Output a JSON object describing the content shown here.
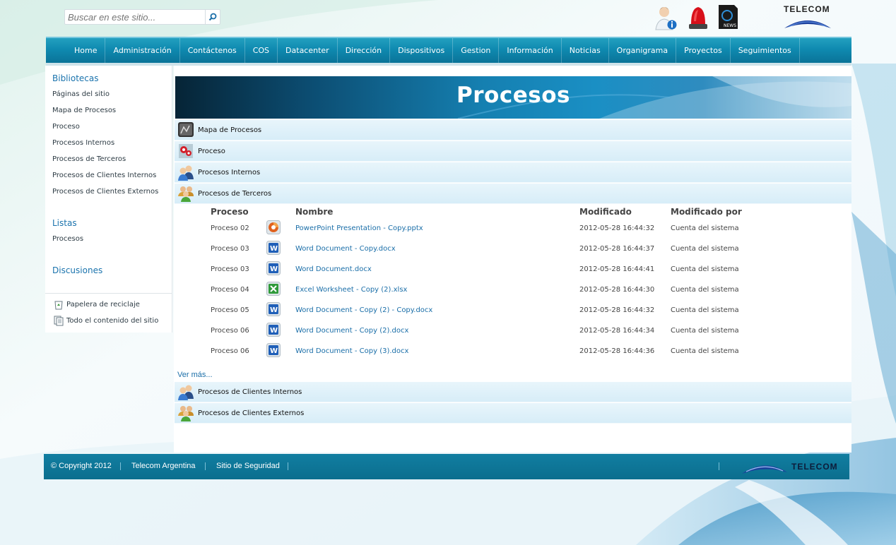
{
  "search": {
    "placeholder": "Buscar en este sitio..."
  },
  "header": {
    "brand": "TELECOM",
    "icons": [
      "user-info-icon",
      "alarm-light-icon",
      "news-icon"
    ]
  },
  "nav": {
    "items": [
      "Home",
      "Administración",
      "Contáctenos",
      "COS",
      "Datacenter",
      "Dirección",
      "Dispositivos",
      "Gestion",
      "Información",
      "Noticias",
      "Organigrama",
      "Proyectos",
      "Seguimientos"
    ]
  },
  "sidebar": {
    "bibliotecas": {
      "heading": "Bibliotecas",
      "items": [
        "Páginas del sitio",
        "Mapa de Procesos",
        "Proceso",
        "Procesos Internos",
        "Procesos de Terceros",
        "Procesos de Clientes Internos",
        "Procesos de Clientes Externos"
      ]
    },
    "listas": {
      "heading": "Listas",
      "items": [
        "Procesos"
      ]
    },
    "discusiones": {
      "heading": "Discusiones"
    },
    "utilities": [
      "Papelera de reciclaje",
      "Todo el contenido del sitio"
    ]
  },
  "main": {
    "title": "Procesos",
    "sections_top": [
      "Mapa de Procesos",
      "Proceso",
      "Procesos Internos",
      "Procesos de Terceros"
    ],
    "table": {
      "headers": {
        "proceso": "Proceso",
        "nombre": "Nombre",
        "modificado": "Modificado",
        "modificado_por": "Modificado por"
      },
      "rows": [
        {
          "proceso": "Proceso 02",
          "type": "pptx",
          "nombre": "PowerPoint Presentation - Copy.pptx",
          "modificado": "2012-05-28 16:44:32",
          "por": "Cuenta del sistema"
        },
        {
          "proceso": "Proceso 03",
          "type": "docx",
          "nombre": "Word Document - Copy.docx",
          "modificado": "2012-05-28 16:44:37",
          "por": "Cuenta del sistema"
        },
        {
          "proceso": "Proceso 03",
          "type": "docx",
          "nombre": "Word Document.docx",
          "modificado": "2012-05-28 16:44:41",
          "por": "Cuenta del sistema"
        },
        {
          "proceso": "Proceso 04",
          "type": "xlsx",
          "nombre": "Excel Worksheet - Copy (2).xlsx",
          "modificado": "2012-05-28 16:44:30",
          "por": "Cuenta del sistema"
        },
        {
          "proceso": "Proceso 05",
          "type": "docx",
          "nombre": "Word Document - Copy (2) - Copy.docx",
          "modificado": "2012-05-28 16:44:32",
          "por": "Cuenta del sistema"
        },
        {
          "proceso": "Proceso 06",
          "type": "docx",
          "nombre": "Word Document - Copy (2).docx",
          "modificado": "2012-05-28 16:44:34",
          "por": "Cuenta del sistema"
        },
        {
          "proceso": "Proceso 06",
          "type": "docx",
          "nombre": "Word Document - Copy (3).docx",
          "modificado": "2012-05-28 16:44:36",
          "por": "Cuenta del sistema"
        }
      ]
    },
    "ver_mas": "Ver más...",
    "sections_bottom": [
      "Procesos de Clientes Internos",
      "Procesos de Clientes Externos"
    ]
  },
  "footer": {
    "copyright": "© Copyright 2012",
    "links": [
      "Telecom Argentina",
      "Sitio de Seguridad"
    ],
    "brand": "TELECOM"
  },
  "colors": {
    "nav": "#0f8ab0",
    "footer": "#0b6e8e",
    "link": "#1a6ea8",
    "section": "#d7edf8"
  }
}
